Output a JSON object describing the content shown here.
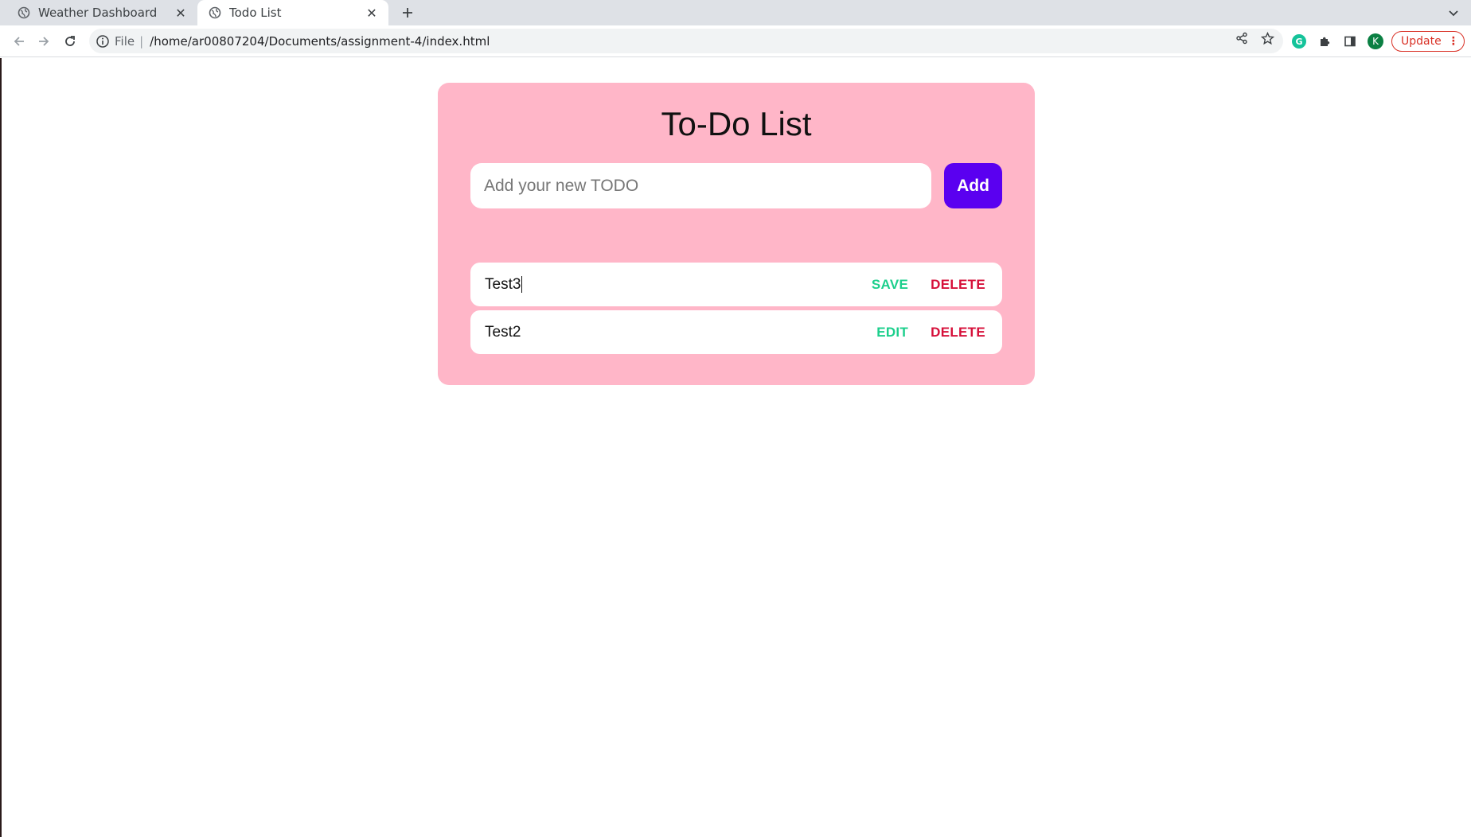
{
  "browser": {
    "tabs": [
      {
        "title": "Weather Dashboard",
        "active": false
      },
      {
        "title": "Todo List",
        "active": true
      }
    ],
    "address": {
      "scheme": "File",
      "url": "/home/ar00807204/Documents/assignment-4/index.html"
    },
    "profile_initial": "K",
    "update_label": "Update"
  },
  "todo": {
    "title": "To-Do List",
    "input_placeholder": "Add your new TODO",
    "add_label": "Add",
    "items": [
      {
        "text": "Test3",
        "primary_action": "SAVE",
        "delete_action": "DELETE",
        "editing": true
      },
      {
        "text": "Test2",
        "primary_action": "EDIT",
        "delete_action": "DELETE",
        "editing": false
      }
    ]
  },
  "colors": {
    "card_background": "#ffb6c8",
    "add_button": "#5a00f0",
    "primary_action": "#1ccf8c",
    "delete_action": "#d6103a"
  }
}
